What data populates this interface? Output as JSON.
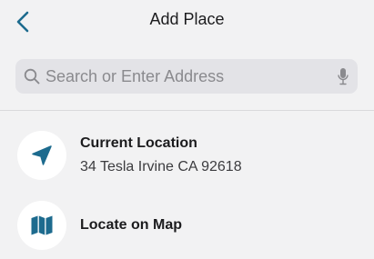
{
  "header": {
    "title": "Add Place",
    "back_icon": "chevron-left-icon"
  },
  "search": {
    "placeholder": "Search or Enter Address",
    "value": "",
    "search_icon": "search-icon",
    "mic_icon": "microphone-icon"
  },
  "places": [
    {
      "title": "Current Location",
      "subtitle": "34 Tesla Irvine CA 92618",
      "icon": "location-arrow-icon"
    },
    {
      "title": "Locate on Map",
      "icon": "map-icon"
    }
  ],
  "colors": {
    "accent": "#1d6b8e",
    "background": "#f2f2f3",
    "search_field": "#e3e3e7",
    "icon_circle": "#ffffff"
  }
}
